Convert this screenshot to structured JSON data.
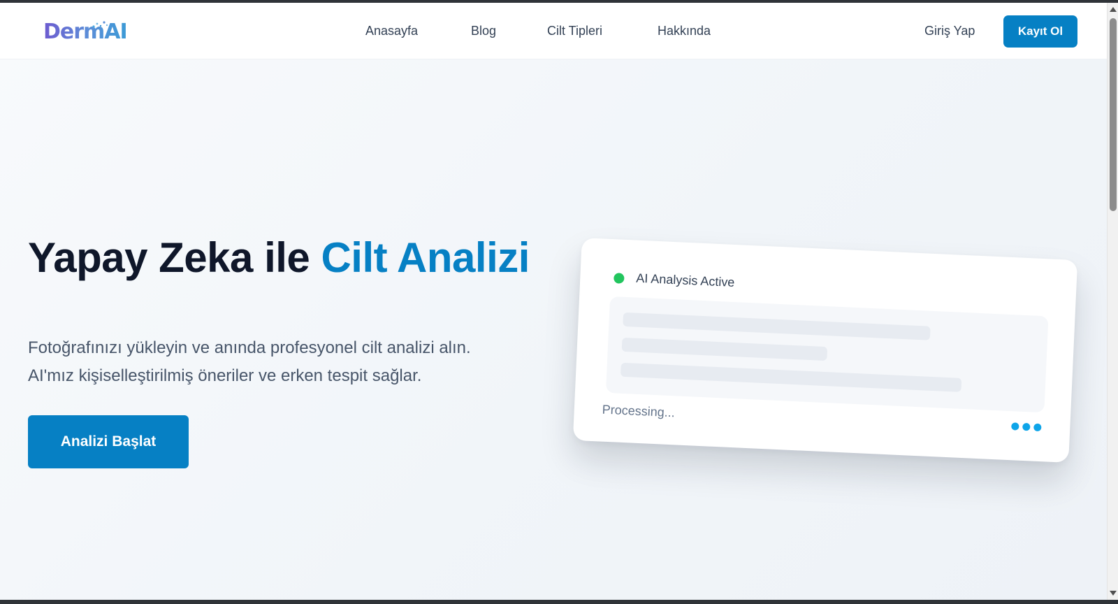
{
  "brand": {
    "logo_text": "DermAI",
    "colors": {
      "primary": "#0680c4",
      "heading": "#0f172a",
      "body_text": "#475569",
      "status_active": "#22c55e",
      "loading_dots": "#0ea5e9"
    }
  },
  "nav": {
    "links": [
      {
        "label": "Anasayfa"
      },
      {
        "label": "Blog"
      },
      {
        "label": "Cilt Tipleri"
      },
      {
        "label": "Hakkında"
      }
    ],
    "login_label": "Giriş Yap",
    "signup_label": "Kayıt Ol"
  },
  "hero": {
    "title_part1": "Yapay Zeka ile ",
    "title_accent": "Cilt Analizi",
    "description_line1": "Fotoğrafınızı yükleyin ve anında profesyonel cilt analizi alın.",
    "description_line2": "AI'mız kişiselleştirilmiş öneriler ve erken tespit sağlar.",
    "cta_label": "Analizi Başlat"
  },
  "analysis_card": {
    "status_text": "AI Analysis Active",
    "processing_text": "Processing...",
    "icons": [
      "status-dot-icon",
      "loading-dots-icon"
    ]
  }
}
